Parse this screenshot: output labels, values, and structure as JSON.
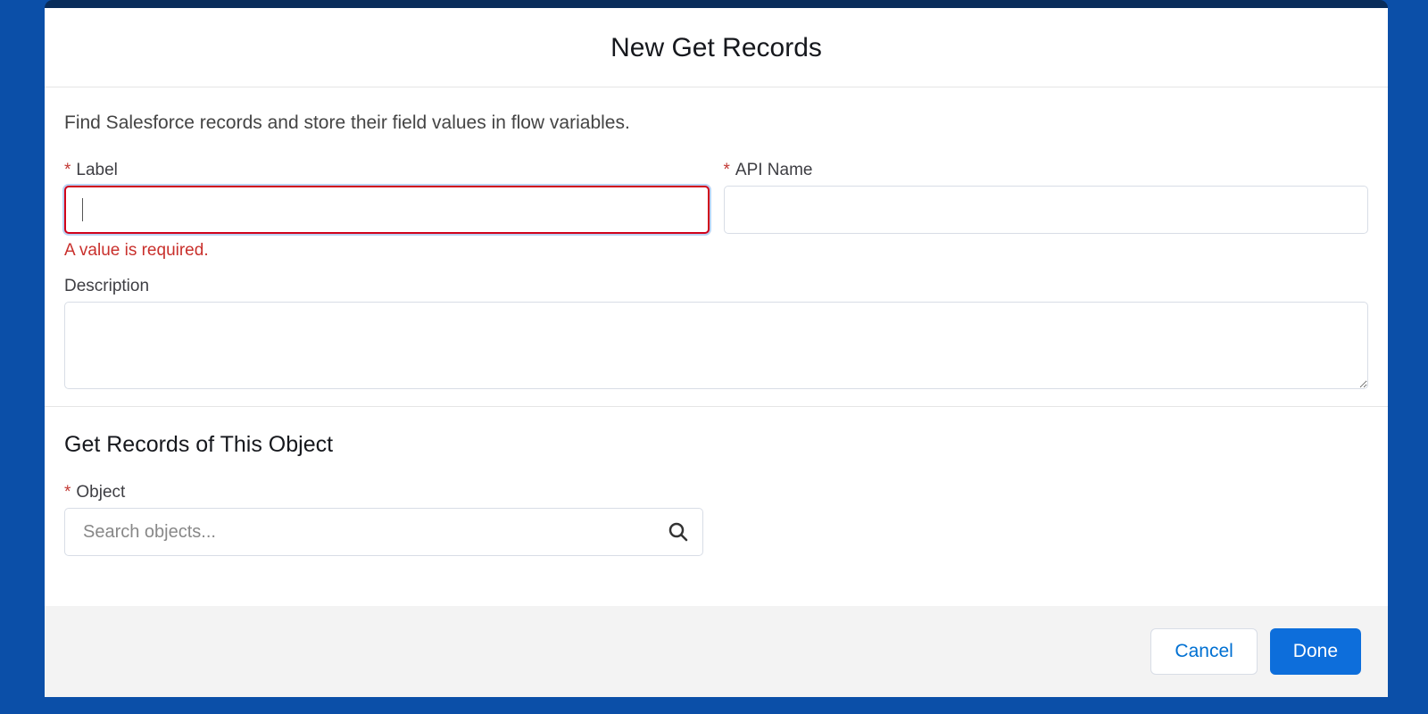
{
  "modal": {
    "title": "New Get Records",
    "intro": "Find Salesforce records and store their field values in flow variables."
  },
  "fields": {
    "label": {
      "label": "Label",
      "value": "",
      "error": "A value is required."
    },
    "apiName": {
      "label": "API Name",
      "value": ""
    },
    "description": {
      "label": "Description",
      "value": ""
    }
  },
  "objectSection": {
    "title": "Get Records of This Object",
    "objectLabel": "Object",
    "placeholder": "Search objects..."
  },
  "footer": {
    "cancel": "Cancel",
    "done": "Done"
  }
}
